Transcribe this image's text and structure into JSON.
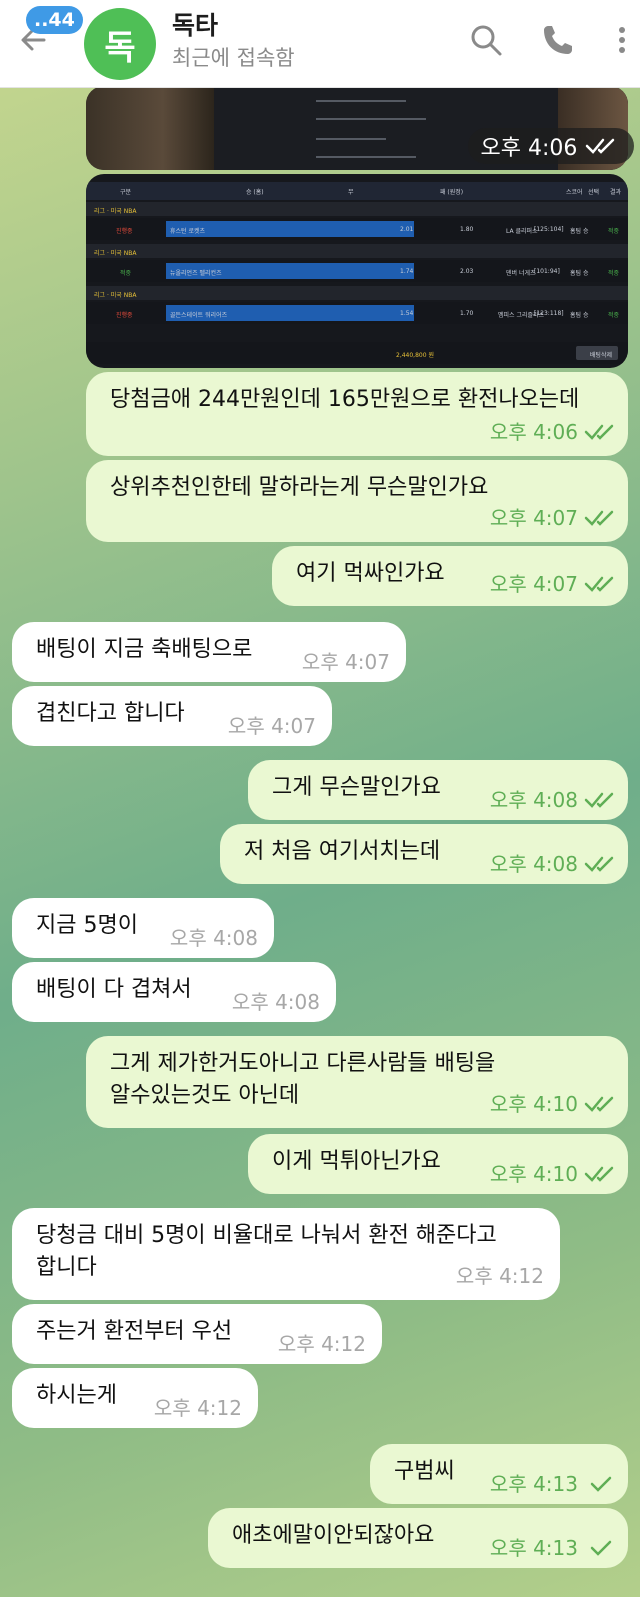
{
  "header": {
    "unread_count": "..44",
    "avatar_initial": "독",
    "title": "독타",
    "status": "최근에 접속함"
  },
  "image_messages": [
    {
      "time": "오후 4:06",
      "read": true
    },
    {
      "table": {
        "columns": [
          "구분",
          "승 (홈)",
          "무",
          "패 (원정)",
          "스코어",
          "선택",
          "결과"
        ],
        "groups": [
          "리그 · 미국 NBA",
          "리그 · 미국 NBA",
          "리그 · 미국 NBA"
        ],
        "rows": [
          {
            "status": "진행중",
            "home": "휴스턴 로켓츠",
            "odd": "2.01",
            "draw": "",
            "draw_odd": "1.80",
            "away": "LA 클리퍼스",
            "score": "[125:104]",
            "pick": "홈팀 승",
            "result": "적중"
          },
          {
            "status": "적중",
            "home": "뉴올리언즈 펠리컨즈",
            "odd": "1.74",
            "draw": "",
            "draw_odd": "2.03",
            "away": "덴버 너게츠",
            "score": "[101:94]",
            "pick": "홈팀 승",
            "result": "적중"
          },
          {
            "status": "진행중",
            "home": "골든스테이트 워리어즈",
            "odd": "1.54",
            "draw": "",
            "draw_odd": "1.70",
            "away": "멤피스 그리즐리스",
            "score": "[123:118]",
            "pick": "홈팀 승",
            "result": "적중"
          }
        ],
        "footer_highlight": "2,440,800 원",
        "footer_button": "배팅삭제"
      }
    }
  ],
  "messages": [
    {
      "dir": "out",
      "text": "당첨금애 244만원인데 165만원으로 환전나오는데",
      "time": "오후 4:06",
      "read": true
    },
    {
      "dir": "out",
      "text": "상위추천인한테 말하라는게 무슨말인가요",
      "time": "오후 4:07",
      "read": true
    },
    {
      "dir": "out",
      "text": "여기 먹싸인가요",
      "time": "오후 4:07",
      "read": true
    },
    {
      "dir": "in",
      "text": "배팅이 지금 축배팅으로",
      "time": "오후 4:07"
    },
    {
      "dir": "in",
      "text": "겹친다고 합니다",
      "time": "오후 4:07"
    },
    {
      "dir": "out",
      "text": "그게 무슨말인가요",
      "time": "오후 4:08",
      "read": true
    },
    {
      "dir": "out",
      "text": "저 처음 여기서치는데",
      "time": "오후 4:08",
      "read": true
    },
    {
      "dir": "in",
      "text": "지금 5명이",
      "time": "오후 4:08"
    },
    {
      "dir": "in",
      "text": "배팅이 다 겹쳐서",
      "time": "오후 4:08"
    },
    {
      "dir": "out",
      "text_line1": "그게 제가한거도아니고 다른사람들 배팅을",
      "text_line2": "알수있는것도 아닌데",
      "time": "오후 4:10",
      "read": true
    },
    {
      "dir": "out",
      "text": "이게 먹튀아닌가요",
      "time": "오후 4:10",
      "read": true
    },
    {
      "dir": "in",
      "text_line1": "당청금 대비 5명이 비율대로 나눠서 환전 해준다고",
      "text_line2": "합니다",
      "time": "오후 4:12"
    },
    {
      "dir": "in",
      "text": "주는거 환전부터 우선",
      "time": "오후 4:12"
    },
    {
      "dir": "in",
      "text": "하시는게",
      "time": "오후 4:12"
    },
    {
      "dir": "out",
      "text": "구범씨",
      "time": "오후 4:13",
      "read": false
    },
    {
      "dir": "out",
      "text": "애초에말이안되잖아요",
      "time": "오후 4:13",
      "read": false
    }
  ],
  "colors": {
    "outgoing_bubble": "#eaf8d2",
    "incoming_bubble": "#ffffff",
    "outgoing_meta": "#5fae55",
    "avatar": "#4fbf56",
    "unread_badge": "#3f9ae6"
  }
}
